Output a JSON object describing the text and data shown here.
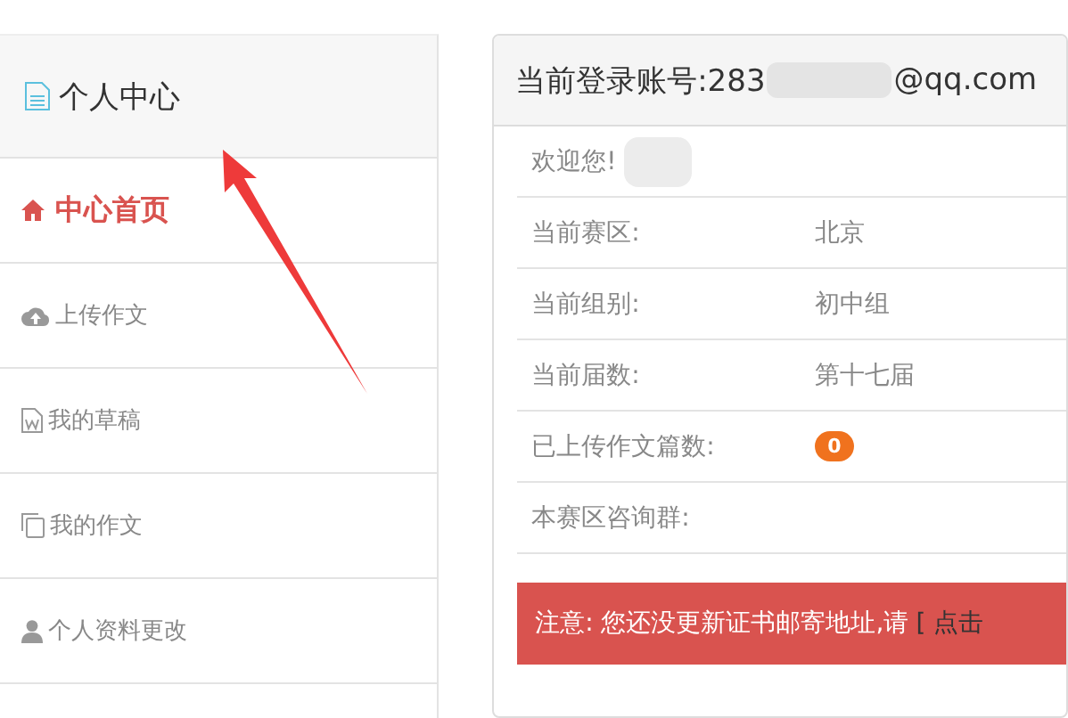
{
  "sidebar": {
    "title": "个人中心",
    "items": [
      {
        "label": "中心首页",
        "selected": true
      },
      {
        "label": "上传作文",
        "selected": false
      },
      {
        "label": "我的草稿",
        "selected": false
      },
      {
        "label": "我的作文",
        "selected": false
      },
      {
        "label": "个人资料更改",
        "selected": false
      }
    ]
  },
  "panel": {
    "account_label": "当前登录账号:283",
    "account_suffix": "@qq.com",
    "welcome": "欢迎您!",
    "rows": [
      {
        "label": "当前赛区:",
        "value": "北京",
        "kind": "text"
      },
      {
        "label": "当前组别:",
        "value": "初中组",
        "kind": "text"
      },
      {
        "label": "当前届数:",
        "value": "第十七届",
        "kind": "text"
      },
      {
        "label": "已上传作文篇数:",
        "value": "0",
        "kind": "badge"
      },
      {
        "label": "本赛区咨询群:",
        "kind": "text"
      }
    ],
    "alert": {
      "message": "注意: 您还没更新证书邮寄地址,请",
      "link": "[ 点击"
    }
  }
}
